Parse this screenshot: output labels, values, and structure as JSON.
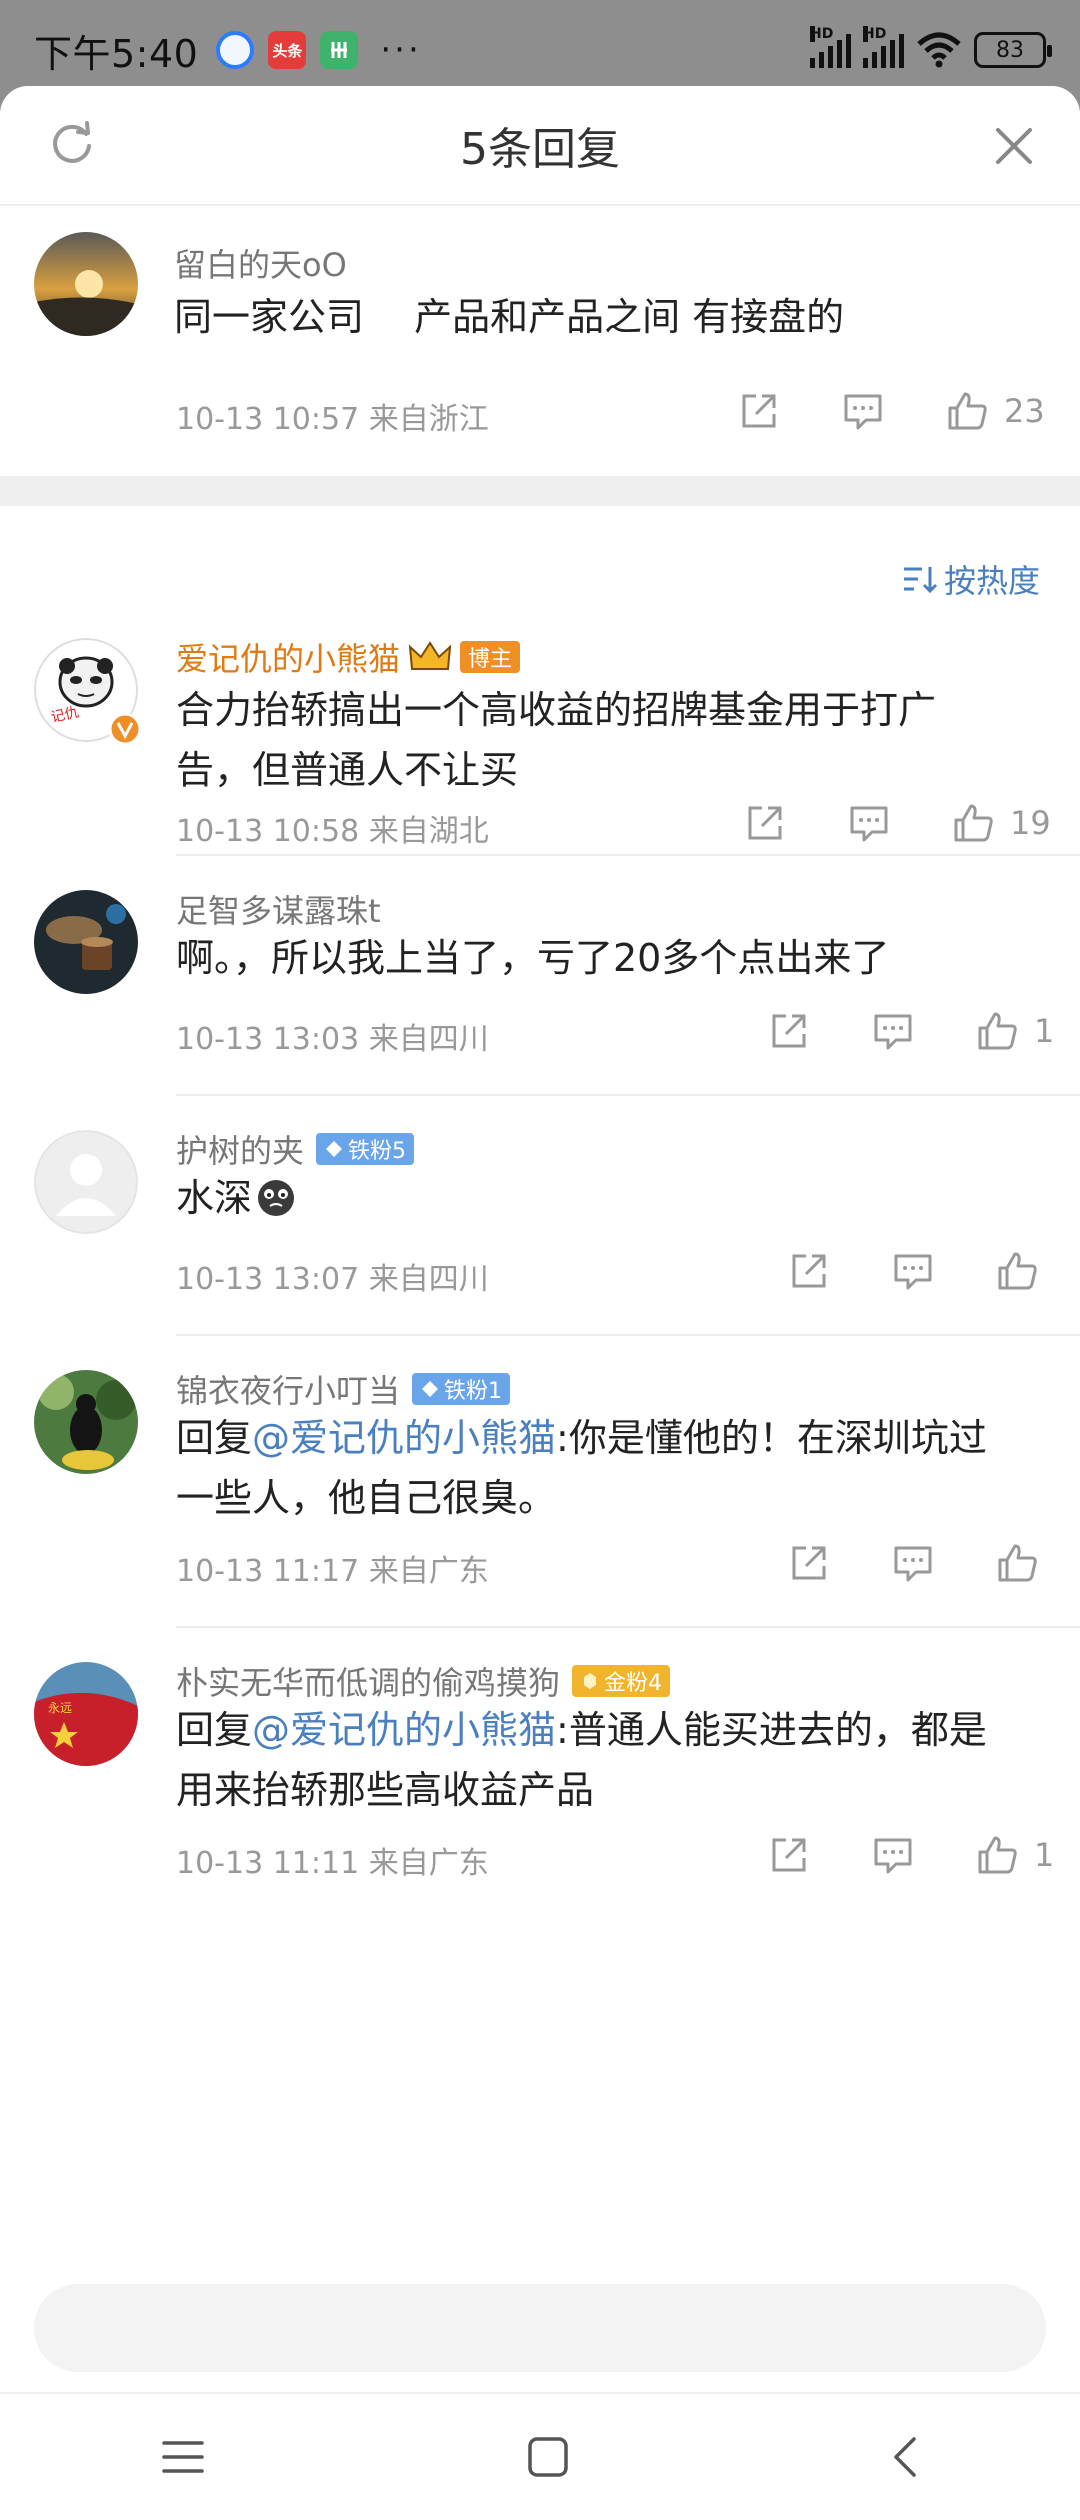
{
  "status_bar": {
    "time": "下午5:40",
    "app_badges": [
      "",
      "头条",
      ""
    ],
    "more": "···",
    "battery": "83",
    "hd1": "HD",
    "hd2": "HD"
  },
  "header": {
    "title": "5条回复"
  },
  "root": {
    "username": "留白的天oO",
    "text": "同一家公司　 产品和产品之间 有接盘的",
    "meta": "10-13 10:57  来自浙江",
    "likes": "23"
  },
  "sort_label": "按热度",
  "replies": [
    {
      "username": "爱记仇的小熊猫",
      "badge": "博主",
      "text_lines": [
        "合力抬轿搞出一个高收益的招牌基金用于打广",
        "告，但普通人不让买"
      ],
      "meta": "10-13 10:58  来自湖北",
      "likes": "19"
    },
    {
      "username": "足智多谋露珠t",
      "text_lines": [
        "啊。，所以我上当了，亏了20多个点出来了"
      ],
      "meta": "10-13 13:03  来自四川",
      "likes": "1"
    },
    {
      "username": "护树的夹",
      "badge": "铁粉5",
      "text_lines": [
        "水深"
      ],
      "meta": "10-13 13:07  来自四川",
      "likes": ""
    },
    {
      "username": "锦衣夜行小叮当",
      "badge": "铁粉1",
      "reply_prefix": "回复",
      "mention": "@爱记仇的小熊猫",
      "text_lines": [
        ":你是懂他的！在深圳坑过",
        "一些人，他自己很臭。"
      ],
      "meta": "10-13 11:17  来自广东",
      "likes": ""
    },
    {
      "username": "朴实无华而低调的偷鸡摸狗",
      "badge": "金粉4",
      "reply_prefix": "回复",
      "mention": "@爱记仇的小熊猫",
      "text_lines": [
        ":普通人能买进去的，都是",
        "用来抬轿那些高收益产品"
      ],
      "meta": "10-13 11:11  来自广东",
      "likes": "1"
    }
  ],
  "colors": {
    "accent": "#4a80c0",
    "blogger_name": "#e07a12",
    "fan_badge": "#6aa5ea",
    "gold_badge": "#f1b52d"
  }
}
